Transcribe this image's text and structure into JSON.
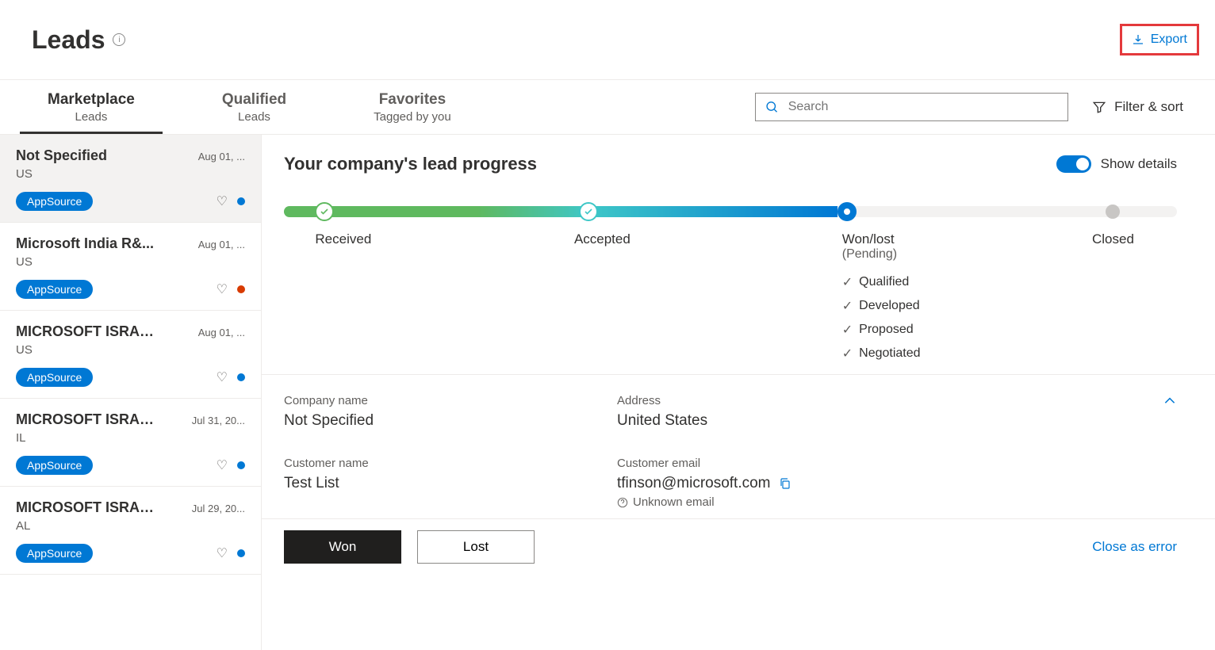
{
  "header": {
    "title": "Leads",
    "export": "Export"
  },
  "tabs": [
    {
      "title": "Marketplace",
      "sub": "Leads"
    },
    {
      "title": "Qualified",
      "sub": "Leads"
    },
    {
      "title": "Favorites",
      "sub": "Tagged by you"
    }
  ],
  "search": {
    "placeholder": "Search"
  },
  "filter_sort": "Filter & sort",
  "list": [
    {
      "name": "Not Specified",
      "date": "Aug 01, ...",
      "loc": "US",
      "pill": "AppSource",
      "dot": "blue",
      "selected": true
    },
    {
      "name": "Microsoft India R&...",
      "date": "Aug 01, ...",
      "loc": "US",
      "pill": "AppSource",
      "dot": "orange"
    },
    {
      "name": "MICROSOFT ISRAE...",
      "date": "Aug 01, ...",
      "loc": "US",
      "pill": "AppSource",
      "dot": "blue"
    },
    {
      "name": "MICROSOFT ISRAE...",
      "date": "Jul 31, 20...",
      "loc": "IL",
      "pill": "AppSource",
      "dot": "blue"
    },
    {
      "name": "MICROSOFT ISRAE...",
      "date": "Jul 29, 20...",
      "loc": "AL",
      "pill": "AppSource",
      "dot": "blue"
    }
  ],
  "detail": {
    "progress_title": "Your company's lead progress",
    "show_details": "Show details",
    "steps": {
      "received": "Received",
      "accepted": "Accepted",
      "wonlost": "Won/lost",
      "pending": "(Pending)",
      "closed": "Closed"
    },
    "substatus": [
      "Qualified",
      "Developed",
      "Proposed",
      "Negotiated"
    ],
    "fields": {
      "company_label": "Company name",
      "company_value": "Not Specified",
      "address_label": "Address",
      "address_value": "United States",
      "customer_label": "Customer name",
      "customer_value": "Test List",
      "email_label": "Customer email",
      "email_value": "tfinson@microsoft.com",
      "unknown_email": "Unknown email"
    },
    "actions": {
      "won": "Won",
      "lost": "Lost",
      "close_error": "Close as error"
    }
  }
}
